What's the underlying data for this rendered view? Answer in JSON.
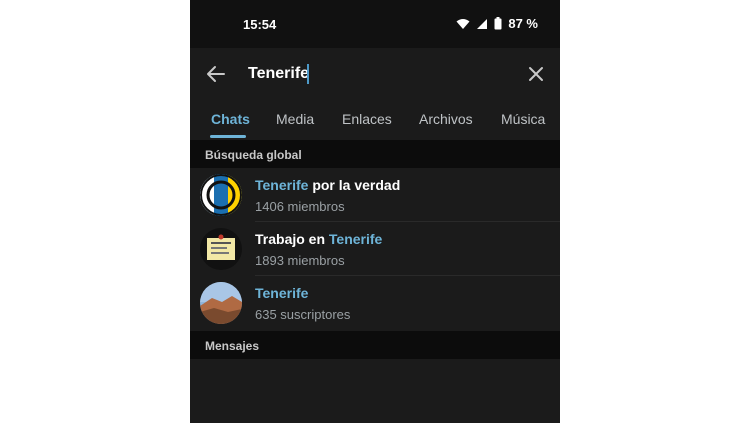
{
  "status_bar": {
    "time": "15:54",
    "battery": "87 %",
    "icons": [
      "wifi-icon",
      "signal-icon",
      "battery-icon"
    ]
  },
  "search": {
    "query": "Tenerife",
    "back_icon": "arrow-left-icon",
    "clear_icon": "close-icon"
  },
  "tabs": [
    {
      "label": "Chats",
      "active": true
    },
    {
      "label": "Media",
      "active": false
    },
    {
      "label": "Enlaces",
      "active": false
    },
    {
      "label": "Archivos",
      "active": false
    },
    {
      "label": "Música",
      "active": false
    }
  ],
  "global_search": {
    "header": "Búsqueda global",
    "results": [
      {
        "title_highlight": "Tenerife",
        "title_rest": " por la verdad",
        "subtitle": "1406 miembros"
      },
      {
        "title_prefix": "Trabajo en ",
        "title_highlight": "Tenerife",
        "subtitle": "1893 miembros"
      },
      {
        "title_highlight": "Tenerife",
        "subtitle": "635 suscriptores"
      }
    ]
  },
  "messages": {
    "header": "Mensajes"
  },
  "colors": {
    "accent": "#6eb4d8",
    "background": "#1b1b1b",
    "section_header_bg": "#0c0c0c"
  }
}
